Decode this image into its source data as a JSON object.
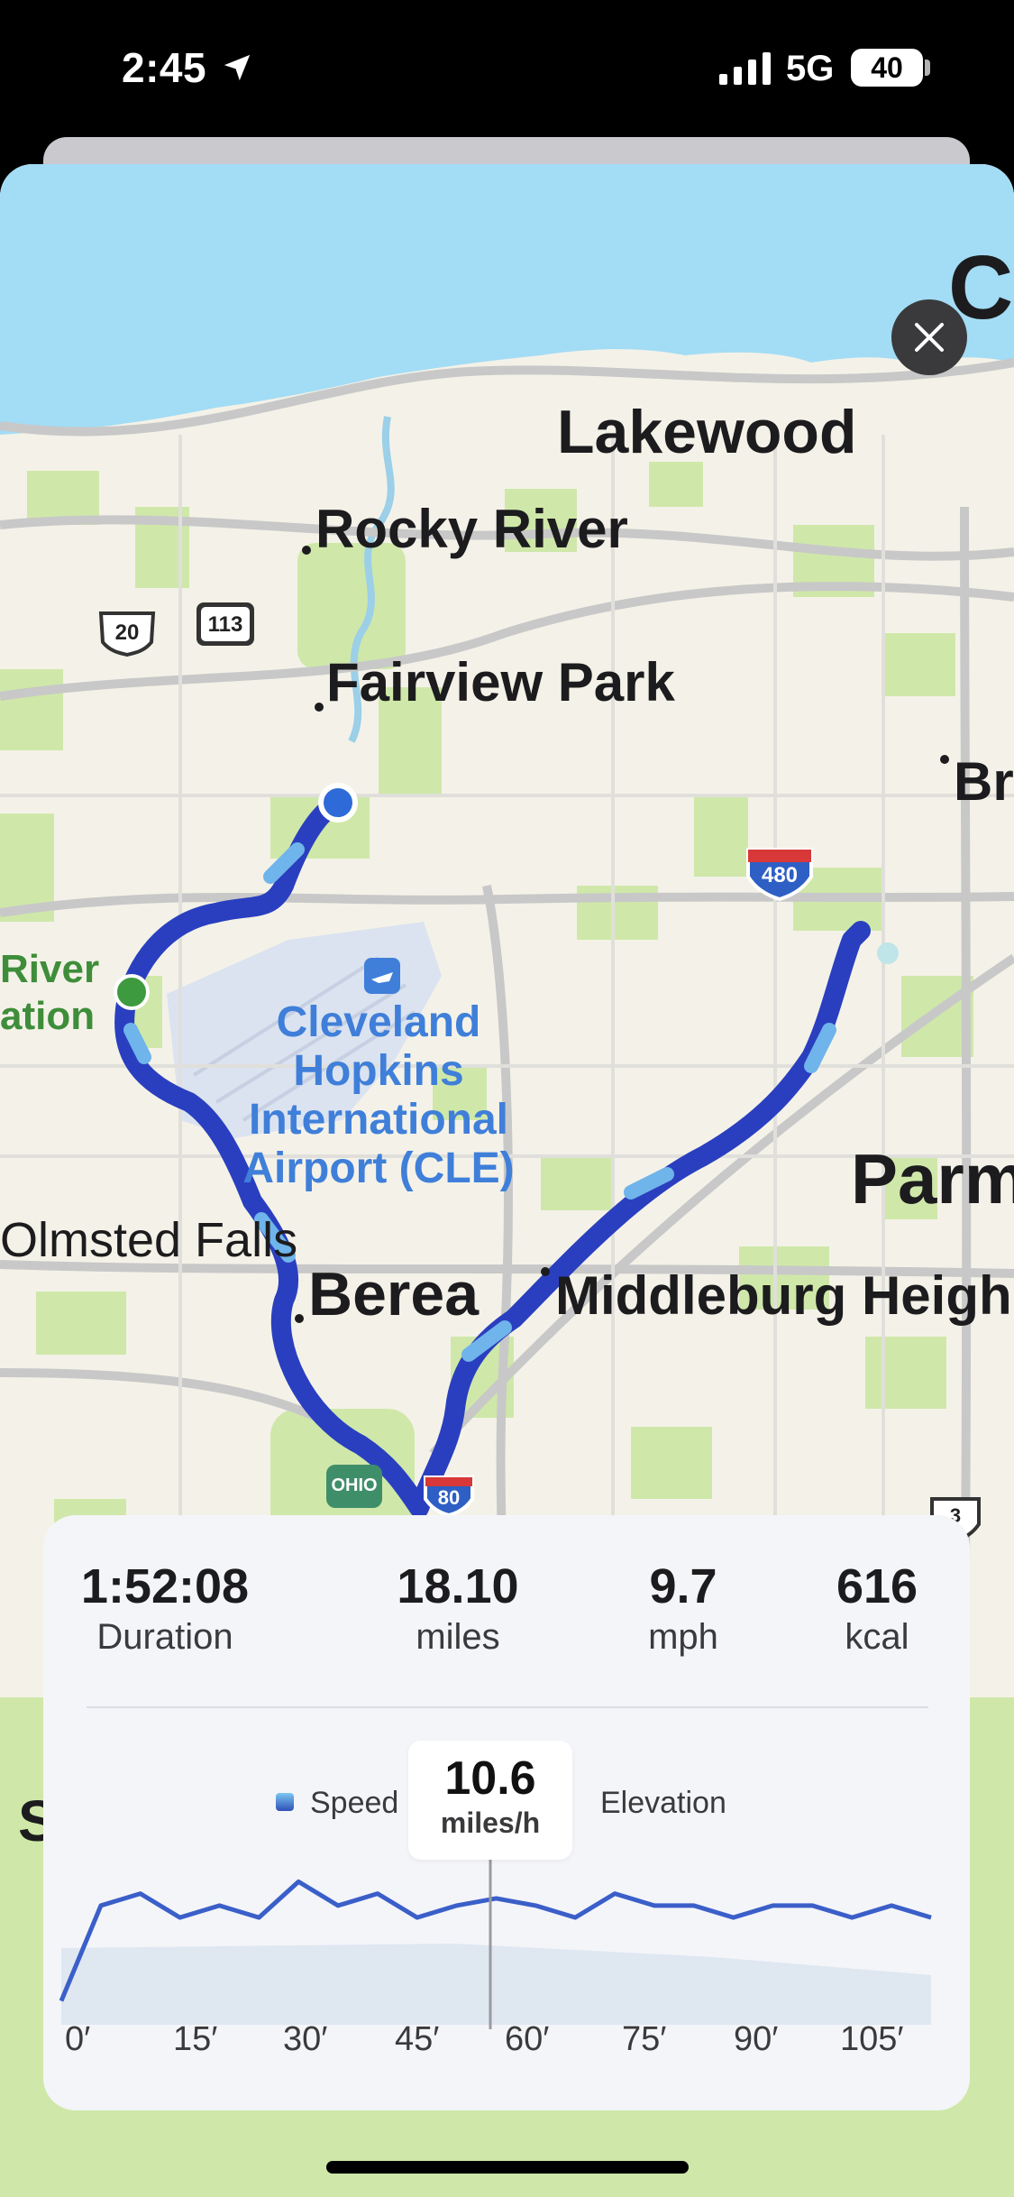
{
  "status_bar": {
    "time": "2:45",
    "network": "5G",
    "battery": "40"
  },
  "map": {
    "places": {
      "lakewood": "Lakewood",
      "rocky_river": "Rocky River",
      "fairview_park": "Fairview Park",
      "brooklyn_partial": "Br",
      "cleveland_partial": "C",
      "parma_partial": "Parm",
      "olmsted_falls": "Olmsted Falls",
      "berea": "Berea",
      "middleburg_heights": "Middleburg Heigh",
      "s_partial": "S"
    },
    "park_label": [
      "River",
      "ation"
    ],
    "airport": [
      "Cleveland",
      "Hopkins",
      "International",
      "Airport (CLE)"
    ],
    "shields": {
      "us20": "20",
      "sr113": "113",
      "i480": "480",
      "ohio": "OHIO",
      "i80": "80",
      "sr3": "3"
    },
    "colors": {
      "route": "#2a3fbf",
      "water": "#a3dcf5",
      "green": "#cfe8a9",
      "land": "#f4f2e8"
    }
  },
  "stats": [
    {
      "value": "1:52:08",
      "label": "Duration"
    },
    {
      "value": "18.10",
      "label": "miles"
    },
    {
      "value": "9.7",
      "label": "mph"
    },
    {
      "value": "616",
      "label": "kcal"
    }
  ],
  "chart": {
    "legend_speed": "Speed",
    "legend_elevation": "Elevation",
    "tooltip_value": "10.6",
    "tooltip_unit": "miles/h",
    "x_ticks": [
      "0′",
      "15′",
      "30′",
      "45′",
      "60′",
      "75′",
      "90′",
      "105′"
    ]
  },
  "chart_data": {
    "type": "line",
    "x": [
      0,
      5,
      10,
      15,
      20,
      25,
      30,
      35,
      40,
      45,
      50,
      55,
      60,
      65,
      70,
      75,
      80,
      85,
      90,
      95,
      100,
      105,
      110
    ],
    "series": [
      {
        "name": "Speed",
        "values": [
          2,
          10,
          11,
          9,
          10,
          9,
          12,
          10,
          11,
          9,
          10,
          10.6,
          10,
          9,
          11,
          10,
          10,
          9,
          10,
          10,
          9,
          10,
          9
        ]
      }
    ],
    "x_ticks": [
      "0′",
      "15′",
      "30′",
      "45′",
      "60′",
      "75′",
      "90′",
      "105′"
    ],
    "grid": false
  }
}
